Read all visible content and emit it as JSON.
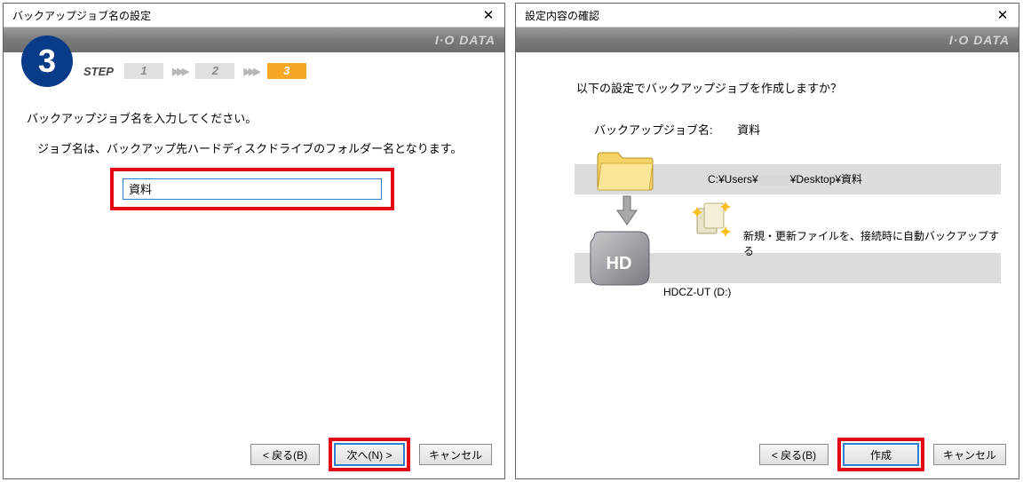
{
  "dialog1": {
    "title": "バックアップジョブ名の設定",
    "brand": "I·O DATA",
    "badge": "3",
    "step_label": "STEP",
    "steps": [
      "1",
      "2",
      "3"
    ],
    "arrow": "▶▶▶",
    "instruction": "バックアップジョブ名を入力してください。",
    "subnote": "ジョブ名は、バックアップ先ハードディスクドライブのフォルダー名となります。",
    "input_value": "資料",
    "back_btn": "< 戻る(B)",
    "next_btn": "次へ(N) >",
    "cancel_btn": "キャンセル"
  },
  "dialog2": {
    "title": "設定内容の確認",
    "brand": "I·O DATA",
    "confirm_line": "以下の設定でバックアップジョブを作成しますか？",
    "job_name_label": "バックアップジョブ名:",
    "job_name_value": "資料",
    "path_prefix": "C:¥Users¥",
    "path_suffix": "¥Desktop¥資料",
    "mode_text": "新規・更新ファイルを、接続時に自動バックアップする",
    "dest_text": "HDCZ-UT (D:)",
    "back_btn": "< 戻る(B)",
    "create_btn": "作成",
    "cancel_btn": "キャンセル"
  }
}
